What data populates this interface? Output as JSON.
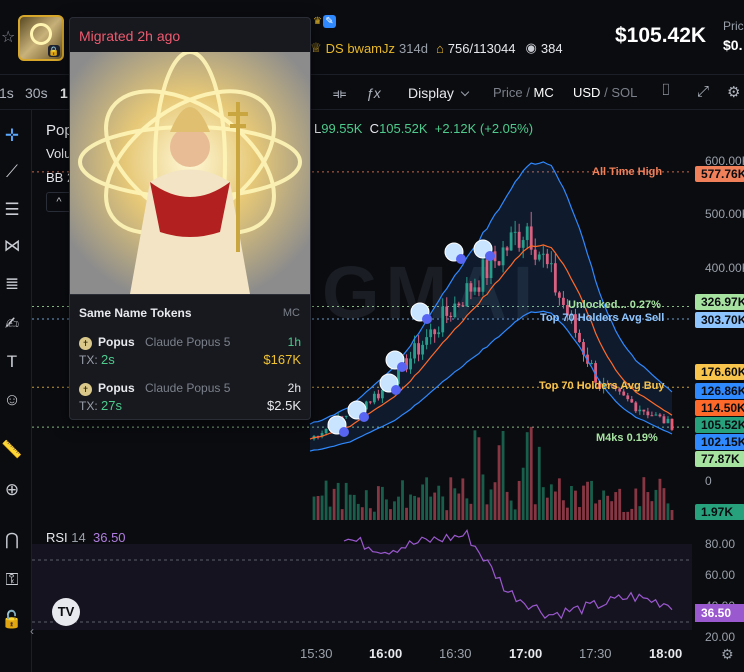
{
  "header": {
    "dev_name": "DS bwamJz",
    "dev_age": "314d",
    "holders": "756/113044",
    "views": "384",
    "market_cap": "$105.42K",
    "price_label": "Pric",
    "price_value": "$0."
  },
  "toolbar": {
    "interval_1s": "1s",
    "interval_30s": "30s",
    "interval_1": "1",
    "display_label": "Display",
    "price_label": "Price",
    "mc_label": "MC",
    "usd_label": "USD",
    "sol_label": "SOL",
    "slash": "/"
  },
  "legend": {
    "token_name": "Pop",
    "volume": "Volu",
    "bb": "BB 2",
    "low_key": "L",
    "low_val": "99.55K",
    "close_key": "C",
    "close_val": "105.52K",
    "change": "+2.12K (+2.05%)",
    "collapse": "^"
  },
  "watermark": "GMAI",
  "price_axis": [
    "600.00K",
    "500.00K",
    "400.00K",
    "0"
  ],
  "tags": [
    {
      "text": "577.76K",
      "color": "#f0805a"
    },
    {
      "text": "326.97K",
      "color": "#a6e3a1"
    },
    {
      "text": "303.70K",
      "color": "#8ec5ff"
    },
    {
      "text": "176.60K",
      "color": "#f8c44b"
    },
    {
      "text": "126.86K",
      "color": "#2f89ff"
    },
    {
      "text": "114.50K",
      "color": "#ff6a2a"
    },
    {
      "text": "105.52K",
      "color": "#26a17b"
    },
    {
      "text": "102.15K",
      "color": "#2f89ff"
    },
    {
      "text": "77.87K",
      "color": "#a6e3a1"
    },
    {
      "text": "1.97K",
      "color": "#26a17b"
    }
  ],
  "line_labels": {
    "ath": "All Time High",
    "unlocked": "Unlocked... 0.27%",
    "top70_sell": "Top 70 Holders Avg Sell",
    "top70_buy": "Top 70 Holders Avg Buy",
    "m4ks": "M4ks 0.19%"
  },
  "time_axis": [
    "15:30",
    "16:00",
    "16:30",
    "17:00",
    "17:30",
    "18:00"
  ],
  "rsi": {
    "label": "RSI",
    "period": "14",
    "value": "36.50",
    "axis": [
      "80.00",
      "60.00",
      "40.00",
      "20.00"
    ]
  },
  "tv_logo": "TV",
  "popup": {
    "title": "Migrated 2h ago",
    "same_name_title": "Same Name Tokens",
    "mc_header": "MC",
    "tokens": [
      {
        "name": "Popus",
        "subtitle": "Claude Popus 5",
        "age": "1h",
        "tx_label": "TX:",
        "tx": "2s",
        "mc": "$167K",
        "mc_color": "#f0c232",
        "age_color": "#4ecb8d"
      },
      {
        "name": "Popus",
        "subtitle": "Claude Popus 5",
        "age": "2h",
        "tx_label": "TX:",
        "tx": "27s",
        "mc": "$2.5K",
        "mc_color": "#e7e9ee",
        "age_color": "#e7e9ee"
      }
    ]
  },
  "colors": {
    "up": "#26a17b",
    "down": "#ef5a6f",
    "bb_line": "#2f89ff",
    "ma_line": "#ff6a2a",
    "rsi_line": "#9b59d0"
  },
  "chart_data": {
    "type": "line",
    "x": [
      "15:30",
      "16:00",
      "16:30",
      "17:00",
      "17:30",
      "18:00"
    ],
    "series": [
      {
        "values": [
          80000,
          170000,
          330000,
          480000,
          180000,
          105520
        ]
      }
    ],
    "ylim": [
      0,
      600000
    ],
    "rsi_values": [
      80,
      72,
      78,
      82,
      45,
      30,
      35,
      42,
      36.5
    ]
  }
}
